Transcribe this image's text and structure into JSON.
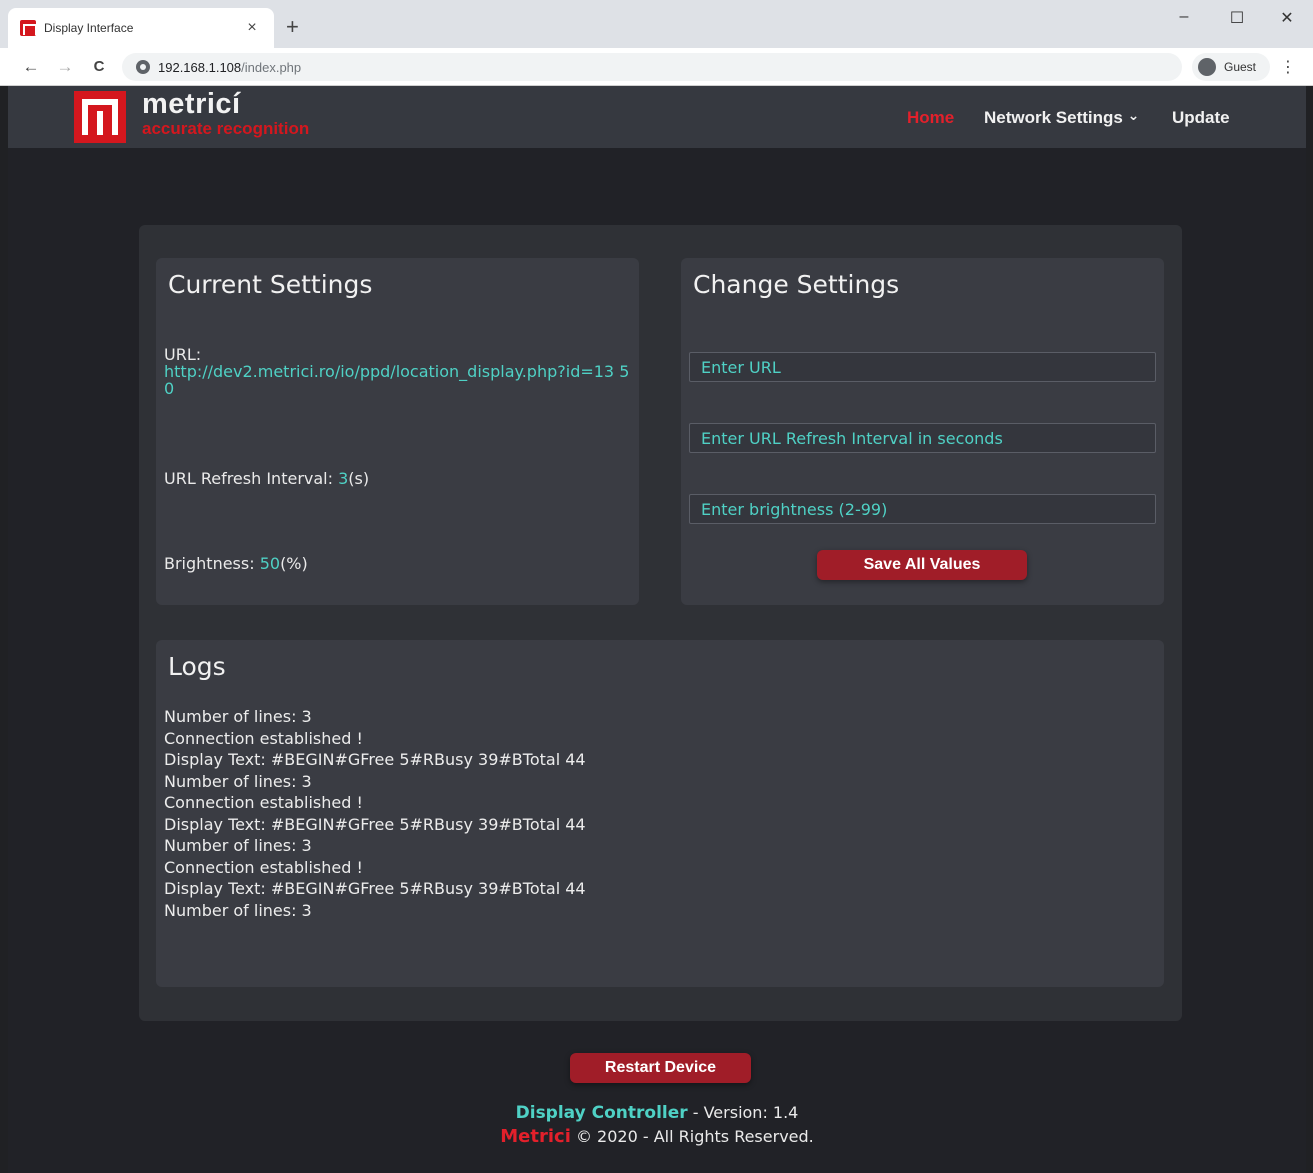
{
  "browser": {
    "tab_title": "Display Interface",
    "tab_close": "×",
    "new_tab": "+",
    "window_controls": {
      "minimize": "–",
      "maximize": "☐",
      "close": "✕"
    },
    "nav": {
      "back": "←",
      "forward": "→",
      "reload": "C"
    },
    "address_host": "192.168.1.108",
    "address_path": "/index.php",
    "profile_label": "Guest",
    "menu": "⋮"
  },
  "navbar": {
    "logo_name": "metricí",
    "logo_tagline": "accurate recognition",
    "links": {
      "home": "Home",
      "network": "Network Settings",
      "network_caret": "⌄",
      "update": "Update"
    }
  },
  "current_settings": {
    "title": "Current Settings",
    "url_label": "URL:",
    "url_value": "http://dev2.metrici.ro/io/ppd/location_display.php?id=13 50",
    "refresh_label": "URL Refresh Interval: ",
    "refresh_value": "3",
    "refresh_unit": "(s)",
    "brightness_label": "Brightness: ",
    "brightness_value": "50",
    "brightness_unit": "(%)"
  },
  "change_settings": {
    "title": "Change Settings",
    "url_placeholder": "Enter URL",
    "refresh_placeholder": "Enter URL Refresh Interval in seconds",
    "brightness_placeholder": "Enter brightness (2-99)",
    "save_label": "Save All Values"
  },
  "logs": {
    "title": "Logs",
    "lines": [
      "Number of lines: 3",
      "Connection established !",
      "Display Text: #BEGIN#GFree 5#RBusy 39#BTotal 44",
      "Number of lines: 3",
      "Connection established !",
      "Display Text: #BEGIN#GFree 5#RBusy 39#BTotal 44",
      "Number of lines: 3",
      "Connection established !",
      "Display Text: #BEGIN#GFree 5#RBusy 39#BTotal 44",
      "Number of lines: 3"
    ]
  },
  "restart_label": "Restart Device",
  "footer": {
    "app_name": "Display Controller",
    "version_text": " - Version: 1.4",
    "company": "Metrici",
    "copyright": " © 2020 - All Rights Reserved."
  },
  "colors": {
    "accent_teal": "#4fd1c5",
    "brand_red": "#e3202b",
    "button_red": "#a01d28"
  }
}
